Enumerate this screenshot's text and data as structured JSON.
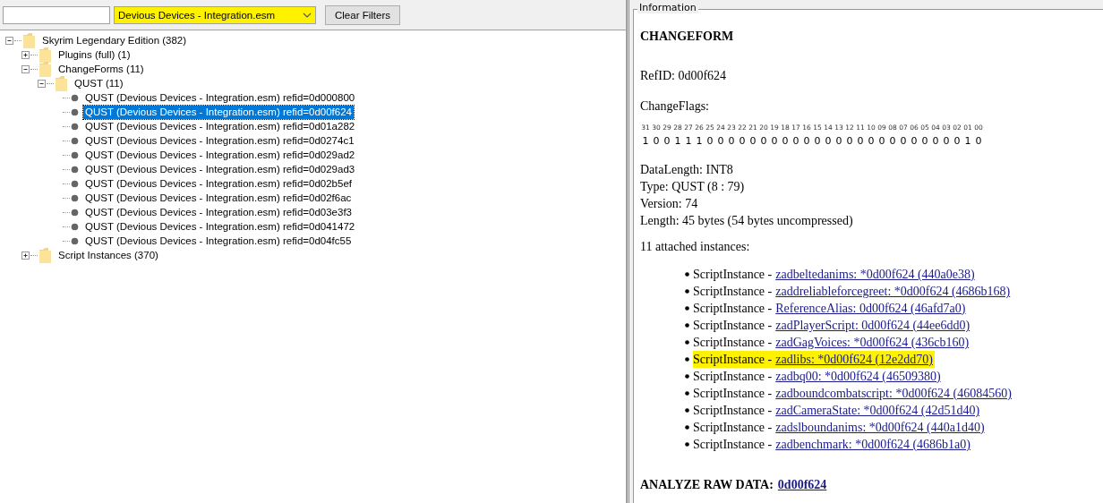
{
  "filter_bar": {
    "plugin_dropdown": {
      "value": "Devious Devices - Integration.esm",
      "highlighted": true
    },
    "clear_button": "Clear Filters"
  },
  "tree": [
    {
      "label": "Skyrim Legendary Edition (382)",
      "kind": "folder",
      "expanded": true,
      "children": [
        {
          "label": "Plugins (full) (1)",
          "kind": "folder",
          "expanded": false
        },
        {
          "label": "ChangeForms (11)",
          "kind": "folder",
          "expanded": true,
          "children": [
            {
              "label": "QUST (11)",
              "kind": "folder",
              "expanded": true,
              "children": [
                {
                  "label": "QUST (Devious Devices - Integration.esm) refid=0d000800",
                  "kind": "record",
                  "selected": false
                },
                {
                  "label": "QUST (Devious Devices - Integration.esm) refid=0d00f624",
                  "kind": "record",
                  "selected": true
                },
                {
                  "label": "QUST (Devious Devices - Integration.esm) refid=0d01a282",
                  "kind": "record",
                  "selected": false
                },
                {
                  "label": "QUST (Devious Devices - Integration.esm) refid=0d0274c1",
                  "kind": "record",
                  "selected": false
                },
                {
                  "label": "QUST (Devious Devices - Integration.esm) refid=0d029ad2",
                  "kind": "record",
                  "selected": false
                },
                {
                  "label": "QUST (Devious Devices - Integration.esm) refid=0d029ad3",
                  "kind": "record",
                  "selected": false
                },
                {
                  "label": "QUST (Devious Devices - Integration.esm) refid=0d02b5ef",
                  "kind": "record",
                  "selected": false
                },
                {
                  "label": "QUST (Devious Devices - Integration.esm) refid=0d02f6ac",
                  "kind": "record",
                  "selected": false
                },
                {
                  "label": "QUST (Devious Devices - Integration.esm) refid=0d03e3f3",
                  "kind": "record",
                  "selected": false
                },
                {
                  "label": "QUST (Devious Devices - Integration.esm) refid=0d041472",
                  "kind": "record",
                  "selected": false
                },
                {
                  "label": "QUST (Devious Devices - Integration.esm) refid=0d04fc55",
                  "kind": "record",
                  "selected": false
                }
              ]
            }
          ]
        },
        {
          "label": "Script Instances (370)",
          "kind": "folder",
          "expanded": false
        }
      ]
    }
  ],
  "information": {
    "group_title": "Information",
    "heading": "CHANGEFORM",
    "refid": "RefID: 0d00f624",
    "flags_label": "ChangeFlags:",
    "flag_bits": [
      "31",
      "30",
      "29",
      "28",
      "27",
      "26",
      "25",
      "24",
      "23",
      "22",
      "21",
      "20",
      "19",
      "18",
      "17",
      "16",
      "15",
      "14",
      "13",
      "12",
      "11",
      "10",
      "09",
      "08",
      "07",
      "06",
      "05",
      "04",
      "03",
      "02",
      "01",
      "00"
    ],
    "flag_values": [
      "1",
      "0",
      "0",
      "1",
      "1",
      "1",
      "0",
      "0",
      "0",
      "0",
      "0",
      "0",
      "0",
      "0",
      "0",
      "0",
      "0",
      "0",
      "0",
      "0",
      "0",
      "0",
      "0",
      "0",
      "0",
      "0",
      "0",
      "0",
      "0",
      "0",
      "1",
      "0"
    ],
    "details": [
      "DataLength: INT8",
      "Type: QUST (8 : 79)",
      "Version: 74",
      "Length: 45 bytes (54 bytes uncompressed)"
    ],
    "instances_label": "11 attached instances:",
    "instances": [
      {
        "prefix": "ScriptInstance -",
        "link": "zadbeltedanims: *0d00f624 (440a0e38)",
        "highlighted": false
      },
      {
        "prefix": "ScriptInstance -",
        "link": "zaddreliableforcegreet: *0d00f624 (4686b168)",
        "highlighted": false
      },
      {
        "prefix": "ScriptInstance -",
        "link": "ReferenceAlias: 0d00f624 (46afd7a0)",
        "highlighted": false
      },
      {
        "prefix": "ScriptInstance -",
        "link": "zadPlayerScript: 0d00f624 (44ee6dd0)",
        "highlighted": false
      },
      {
        "prefix": "ScriptInstance -",
        "link": "zadGagVoices: *0d00f624 (436cb160)",
        "highlighted": false
      },
      {
        "prefix": "ScriptInstance -",
        "link": "zadlibs: *0d00f624 (12e2dd70)",
        "highlighted": true
      },
      {
        "prefix": "ScriptInstance -",
        "link": "zadbq00: *0d00f624 (46509380)",
        "highlighted": false
      },
      {
        "prefix": "ScriptInstance -",
        "link": "zadboundcombatscript: *0d00f624 (46084560)",
        "highlighted": false
      },
      {
        "prefix": "ScriptInstance -",
        "link": "zadCameraState: *0d00f624 (42d51d40)",
        "highlighted": false
      },
      {
        "prefix": "ScriptInstance -",
        "link": "zadslboundanims: *0d00f624 (440a1d40)",
        "highlighted": false
      },
      {
        "prefix": "ScriptInstance -",
        "link": "zadbenchmark: *0d00f624 (4686b1a0)",
        "highlighted": false
      }
    ],
    "raw_label": "ANALYZE RAW DATA:",
    "raw_link": "0d00f624"
  }
}
